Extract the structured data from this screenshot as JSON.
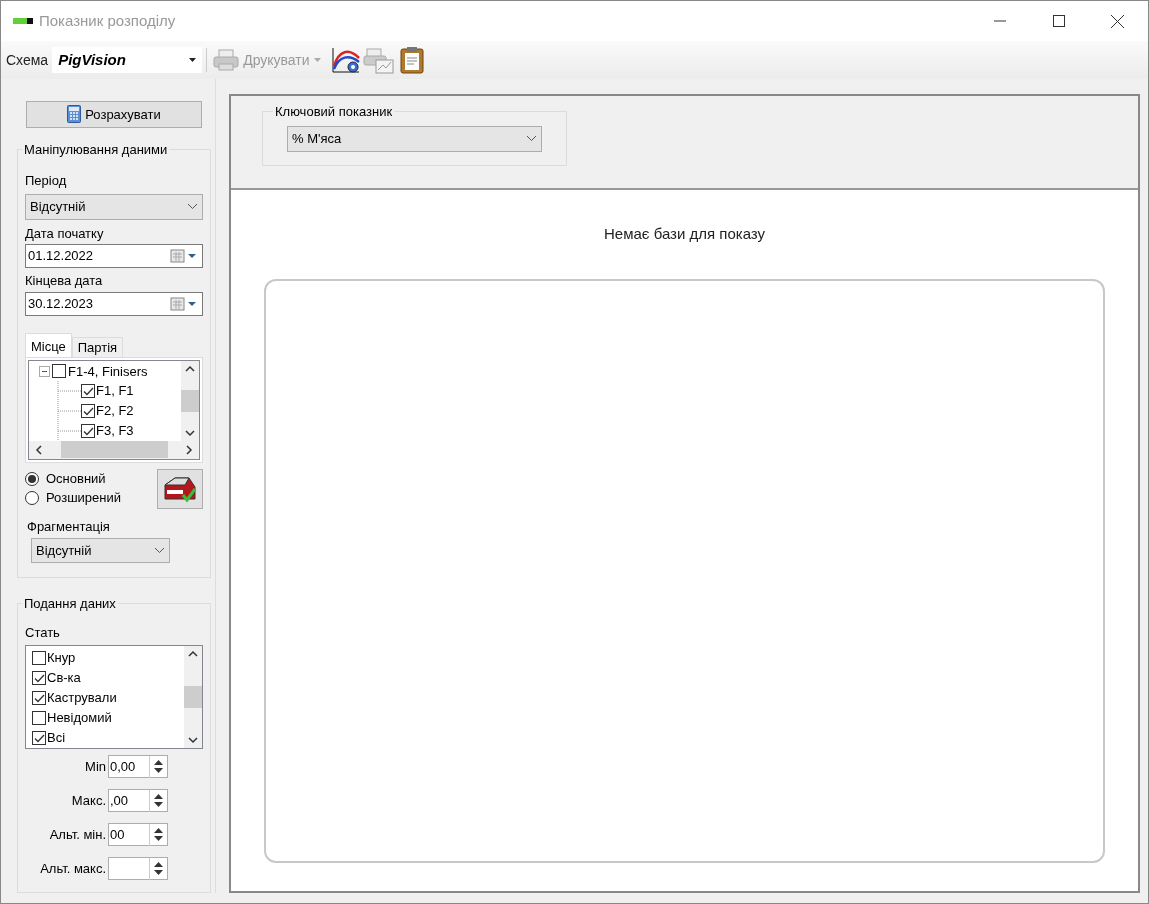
{
  "window": {
    "title": "Показник розподілу"
  },
  "toolbar": {
    "schema_label": "Схема",
    "schema_value": "PigVision",
    "print_button": {
      "label": "Друкувати",
      "disabled": true
    }
  },
  "calculate_button": "Розрахувати",
  "data_manipulation": {
    "title": "Маніпулювання даними",
    "period_label": "Період",
    "period_value": "Відсутній",
    "start_label": "Дата початку",
    "start_value": "01.12.2022",
    "end_label": "Кінцева дата",
    "end_value": "30.12.2023",
    "tabs": [
      {
        "label": "Місце",
        "selected": true
      },
      {
        "label": "Партія",
        "selected": false
      }
    ],
    "tree": [
      {
        "label": "F1-4, Finisers",
        "checked": false,
        "expanded": true,
        "children": [
          {
            "label": "F1, F1",
            "checked": true
          },
          {
            "label": "F2, F2",
            "checked": true
          },
          {
            "label": "F3, F3",
            "checked": true
          }
        ]
      }
    ],
    "modes": [
      {
        "label": "Основний",
        "selected": true
      },
      {
        "label": "Розширений",
        "selected": false
      }
    ],
    "fragmentation_label": "Фрагментація",
    "fragmentation_value": "Відсутній"
  },
  "data_presentation": {
    "title": "Подання даних",
    "sex_label": "Стать",
    "sexes": [
      {
        "label": "Кнур",
        "checked": false
      },
      {
        "label": "Св-ка",
        "checked": true
      },
      {
        "label": "Кастрували",
        "checked": true
      },
      {
        "label": "Невідомий",
        "checked": false
      },
      {
        "label": "Всі",
        "checked": true
      }
    ],
    "limits": [
      {
        "label": "Min",
        "value": "0,00"
      },
      {
        "label": "Макс.",
        "value": ",00"
      },
      {
        "label": "Альт. мін.",
        "value": "00"
      },
      {
        "label": "Альт. макс."
      }
    ]
  },
  "key_indicator": {
    "title": "Ключовий показник",
    "value": "% М'яса"
  },
  "chart_area": {
    "message": "Немає бази для показу"
  }
}
